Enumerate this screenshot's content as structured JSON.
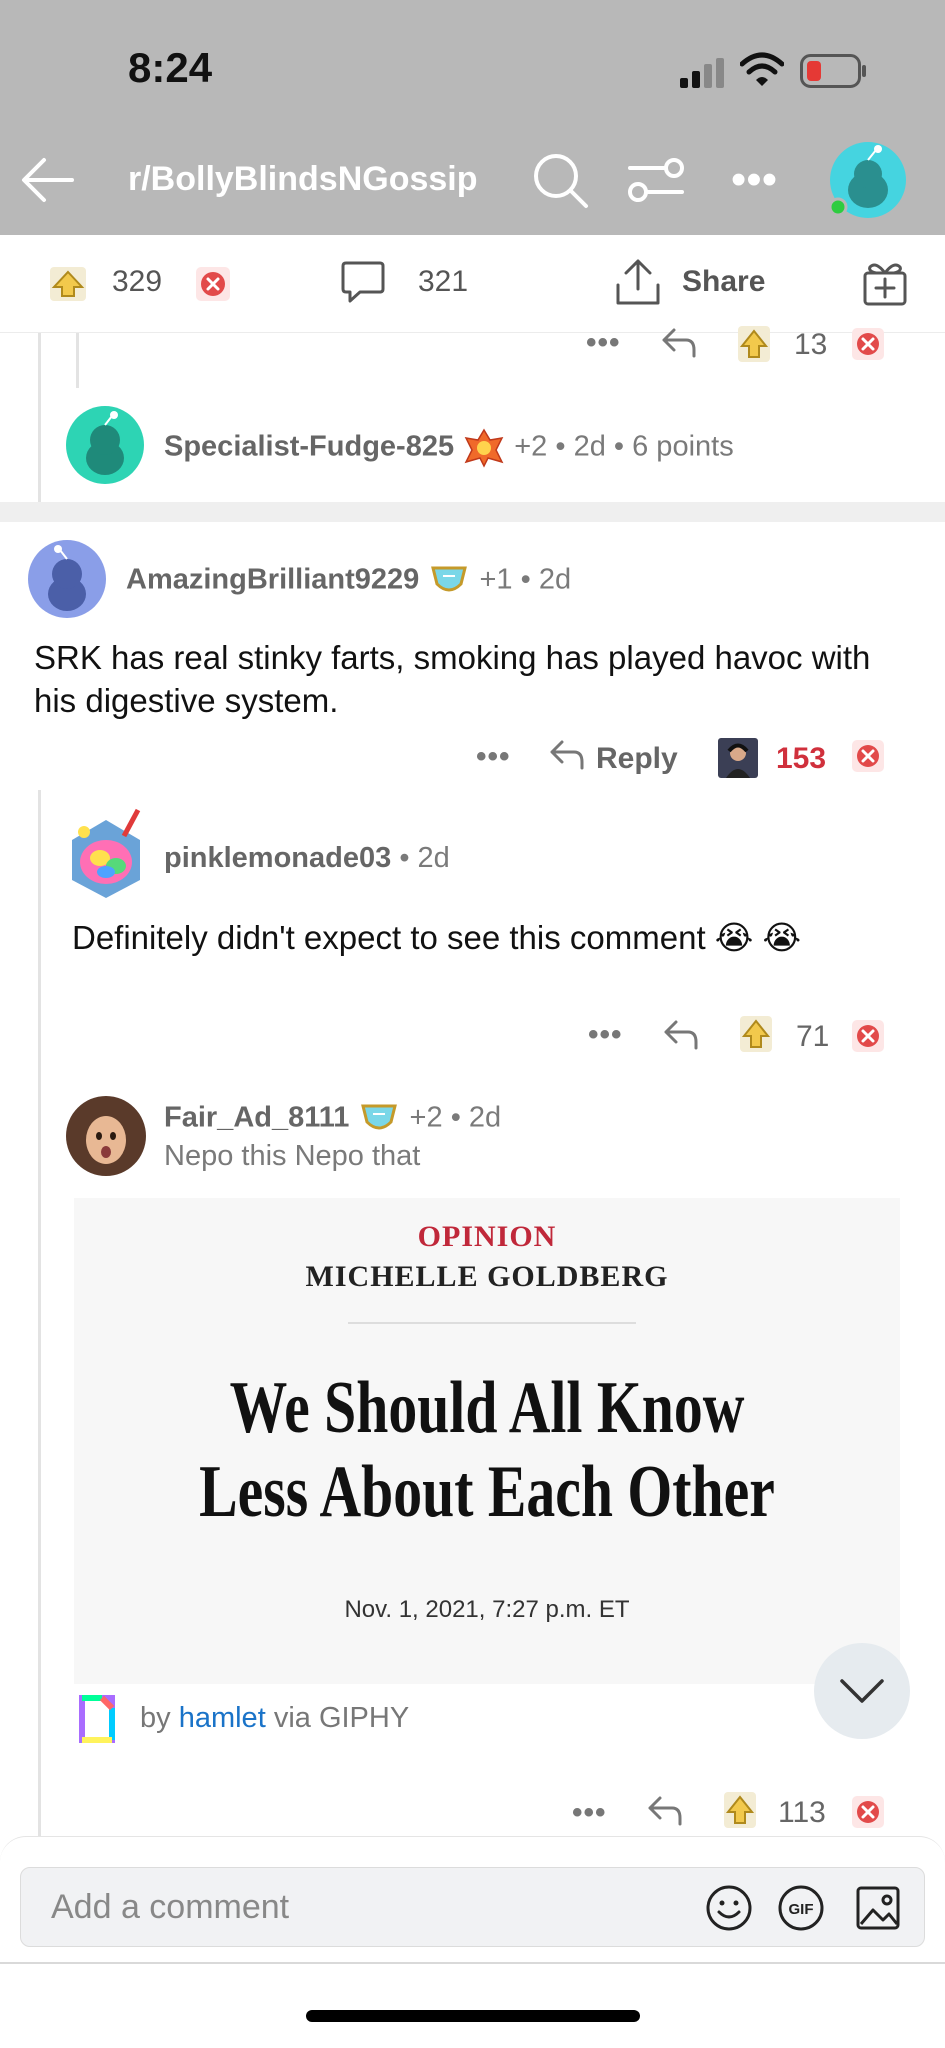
{
  "status": {
    "time": "8:24"
  },
  "nav": {
    "title": "r/BollyBlindsNGossip",
    "more": "•••"
  },
  "post_actions": {
    "upvotes": "329",
    "comments": "321",
    "share": "Share"
  },
  "comments": [
    {
      "actions": {
        "dots": "•••",
        "score": "13"
      }
    },
    {
      "user": "Specialist-Fudge-825",
      "awards_extra": "+2",
      "time": "2d",
      "points": "6 points",
      "sep": "•"
    },
    {
      "user": "AmazingBrilliant9229",
      "awards_extra": "+1",
      "time": "2d",
      "sep": "•",
      "body": "SRK has real stinky farts, smoking has played havoc with his digestive system.",
      "actions": {
        "dots": "•••",
        "reply": "Reply",
        "score": "153"
      }
    },
    {
      "user": "pinklemonade03",
      "time": "2d",
      "sep": "•",
      "body": "Definitely didn't expect to see this comment 😭 😭",
      "actions": {
        "dots": "•••",
        "score": "71"
      }
    },
    {
      "user": "Fair_Ad_8111",
      "awards_extra": "+2",
      "time": "2d",
      "sep": "•",
      "flair": "Nepo this Nepo that",
      "gif": {
        "kicker": "OPINION",
        "author": "MICHELLE GOLDBERG",
        "headline": "We Should All Know Less About Each Other",
        "date": "Nov. 1, 2021, 7:27 p.m. ET"
      },
      "giphy": {
        "by": "by",
        "creator": "hamlet",
        "via": "via GIPHY"
      },
      "actions": {
        "dots": "•••",
        "score": "113"
      }
    }
  ],
  "composer": {
    "placeholder": "Add a comment",
    "gif_label": "GIF"
  },
  "colors": {
    "accent_red": "#d0303c",
    "link_blue": "#1a73c8",
    "upvote_gold": "#f2c94c"
  }
}
